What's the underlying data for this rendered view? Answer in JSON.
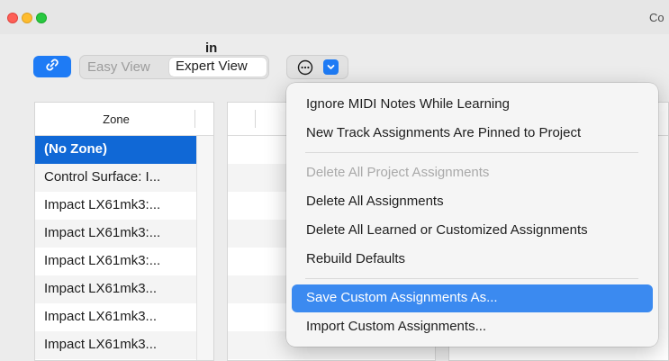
{
  "window": {
    "title": "Co"
  },
  "toolbar": {
    "link_icon": "link-icon",
    "view_modes": [
      "Easy View",
      "Expert View"
    ],
    "selected_view": "Expert View",
    "more_icon": "ellipsis-circle-icon",
    "chevron_icon": "chevron-down-icon"
  },
  "zone_column": {
    "header": "Zone",
    "rows": [
      "(No Zone)",
      "Control Surface: I...",
      "Impact LX61mk3:...",
      "Impact LX61mk3:...",
      "Impact LX61mk3:...",
      "Impact LX61mk3...",
      "Impact LX61mk3...",
      "Impact LX61mk3..."
    ],
    "selected_index": 0
  },
  "right_panel": {
    "partial_text": "in"
  },
  "menu": {
    "items": [
      "Ignore MIDI Notes While Learning",
      "New Track Assignments Are Pinned to Project",
      "Delete All Project Assignments",
      "Delete All Assignments",
      "Delete All Learned or Customized Assignments",
      "Rebuild Defaults",
      "Save Custom Assignments As...",
      "Import Custom Assignments..."
    ],
    "disabled_index": 2,
    "highlighted_index": 6
  },
  "colors": {
    "accent": "#1e7bf5",
    "selection": "#1068d6",
    "menu_highlight": "#3b8af0"
  }
}
